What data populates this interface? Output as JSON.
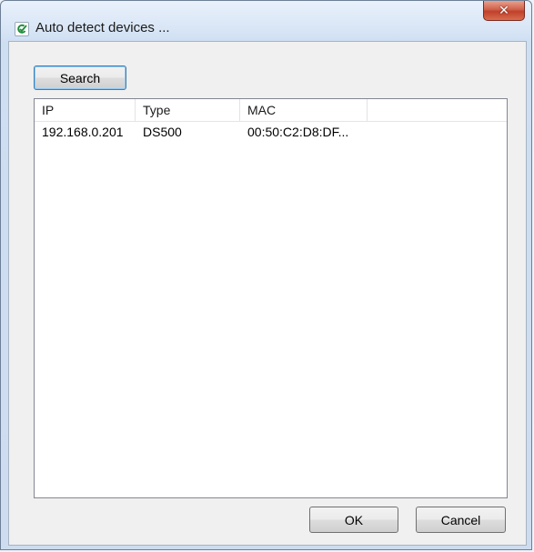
{
  "window": {
    "title": "Auto detect devices ...",
    "close_glyph": "✕"
  },
  "toolbar": {
    "search_label": "Search"
  },
  "list": {
    "columns": [
      "IP",
      "Type",
      "MAC",
      ""
    ],
    "rows": [
      {
        "ip": "192.168.0.201",
        "type": "DS500",
        "mac": "00:50:C2:D8:DF..."
      }
    ]
  },
  "footer": {
    "ok_label": "OK",
    "cancel_label": "Cancel"
  },
  "colors": {
    "accent": "#3c7fb1",
    "close_button": "#c0402a",
    "app_icon": "#1e8c3a"
  },
  "icons": {
    "app": "app-logo-icon",
    "close": "close-icon"
  }
}
